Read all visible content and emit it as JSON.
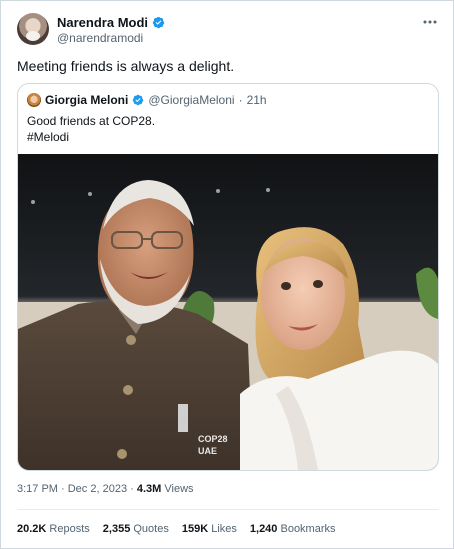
{
  "author": {
    "display_name": "Narendra Modi",
    "handle": "@narendramodi"
  },
  "tweet": {
    "text": "Meeting friends is always a delight."
  },
  "quoted": {
    "display_name": "Giorgia Meloni",
    "handle": "@GiorgiaMeloni",
    "separator": "·",
    "time": "21h",
    "line1": "Good friends at COP28.",
    "line2": "#Melodi"
  },
  "meta": {
    "timestamp": "3:17 PM · Dec 2, 2023",
    "separator": "·",
    "views_count": "4.3M",
    "views_label": "Views"
  },
  "stats": {
    "reposts_count": "20.2K",
    "reposts_label": "Reposts",
    "quotes_count": "2,355",
    "quotes_label": "Quotes",
    "likes_count": "159K",
    "likes_label": "Likes",
    "bookmarks_count": "1,240",
    "bookmarks_label": "Bookmarks"
  },
  "icons": {
    "verified": "verified-badge-icon",
    "more": "more-options-icon"
  },
  "colors": {
    "verified_blue": "#1d9bf0",
    "secondary_text": "#536471",
    "primary_text": "#0f1419",
    "border": "#cfd9de"
  },
  "photo_badge": {
    "line1": "COP28",
    "line2": "UAE"
  }
}
